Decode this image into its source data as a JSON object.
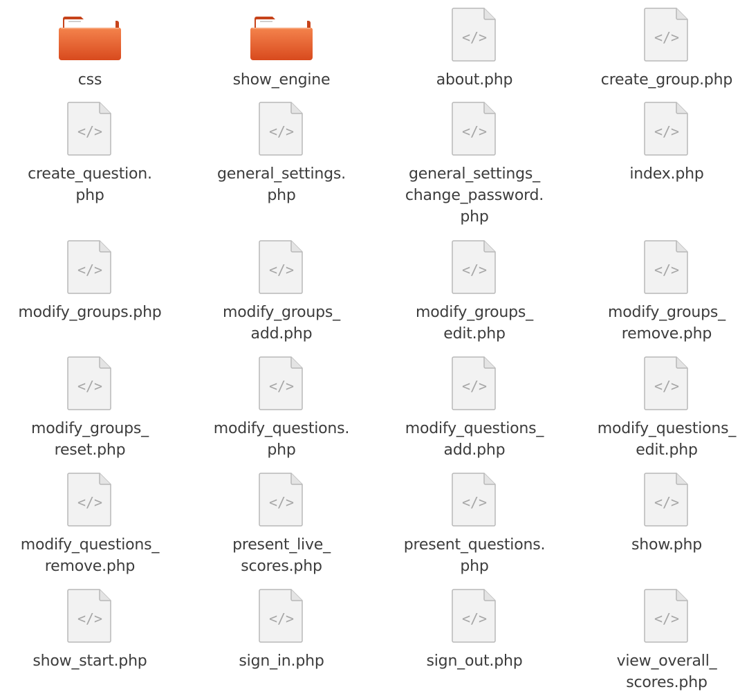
{
  "files": [
    {
      "label": "css",
      "type": "folder"
    },
    {
      "label": "show_engine",
      "type": "folder"
    },
    {
      "label": "about.php",
      "type": "php"
    },
    {
      "label": "create_group.php",
      "type": "php"
    },
    {
      "label": "create_question.\nphp",
      "type": "php"
    },
    {
      "label": "general_settings.\nphp",
      "type": "php"
    },
    {
      "label": "general_settings_\nchange_password.\nphp",
      "type": "php"
    },
    {
      "label": "index.php",
      "type": "php"
    },
    {
      "label": "modify_groups.php",
      "type": "php"
    },
    {
      "label": "modify_groups_\nadd.php",
      "type": "php"
    },
    {
      "label": "modify_groups_\nedit.php",
      "type": "php"
    },
    {
      "label": "modify_groups_\nremove.php",
      "type": "php"
    },
    {
      "label": "modify_groups_\nreset.php",
      "type": "php"
    },
    {
      "label": "modify_questions.\nphp",
      "type": "php"
    },
    {
      "label": "modify_questions_\nadd.php",
      "type": "php"
    },
    {
      "label": "modify_questions_\nedit.php",
      "type": "php"
    },
    {
      "label": "modify_questions_\nremove.php",
      "type": "php"
    },
    {
      "label": "present_live_\nscores.php",
      "type": "php"
    },
    {
      "label": "present_questions.\nphp",
      "type": "php"
    },
    {
      "label": "show.php",
      "type": "php"
    },
    {
      "label": "show_start.php",
      "type": "php"
    },
    {
      "label": "sign_in.php",
      "type": "php"
    },
    {
      "label": "sign_out.php",
      "type": "php"
    },
    {
      "label": "view_overall_\nscores.php",
      "type": "php"
    }
  ],
  "icons": {
    "folder": "folder-icon",
    "php": "php-file-icon"
  },
  "colors": {
    "folder_orange": "#e8592b",
    "folder_tab": "#f29b6e",
    "file_bg": "#f2f2f2",
    "file_border": "#b4b4b4",
    "text": "#3c3c3c"
  }
}
